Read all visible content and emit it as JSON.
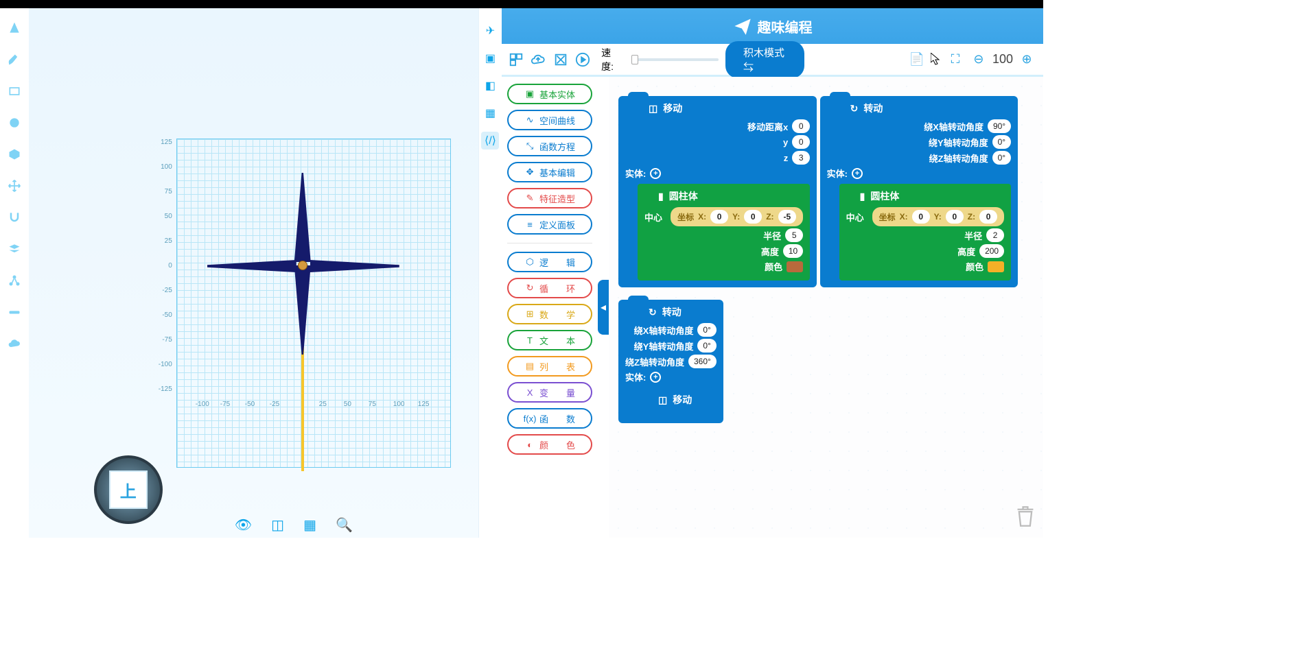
{
  "header": {
    "title": "趣味编程"
  },
  "toolbar": {
    "speed_label": "速度:",
    "mode_button": "积木模式 ⇆",
    "zoom_value": "100"
  },
  "categories_group1": [
    {
      "label": "基本实体",
      "cls": "cat-green",
      "icon": "▣",
      "name": "category-basic-entity"
    },
    {
      "label": "空间曲线",
      "cls": "cat-blue",
      "icon": "∿",
      "name": "category-space-curve"
    },
    {
      "label": "函数方程",
      "cls": "cat-blue",
      "icon": "⤡",
      "name": "category-function"
    },
    {
      "label": "基本编辑",
      "cls": "cat-blue",
      "icon": "✥",
      "name": "category-basic-edit"
    },
    {
      "label": "特征造型",
      "cls": "cat-red",
      "icon": "✎",
      "name": "category-feature"
    },
    {
      "label": "定义面板",
      "cls": "cat-blue",
      "icon": "≡",
      "name": "category-define-panel"
    }
  ],
  "categories_group2": [
    {
      "label": "逻　　辑",
      "cls": "cat-blue",
      "icon": "⬡",
      "name": "category-logic"
    },
    {
      "label": "循　　环",
      "cls": "cat-red",
      "icon": "↻",
      "name": "category-loop"
    },
    {
      "label": "数　　学",
      "cls": "cat-gold",
      "icon": "⊞",
      "name": "category-math"
    },
    {
      "label": "文　　本",
      "cls": "cat-green",
      "icon": "T",
      "name": "category-text"
    },
    {
      "label": "列　　表",
      "cls": "cat-orange",
      "icon": "▤",
      "name": "category-list"
    },
    {
      "label": "变　　量",
      "cls": "cat-violet",
      "icon": "X",
      "name": "category-variable"
    },
    {
      "label": "函　　数",
      "cls": "cat-blue",
      "icon": "f(x)",
      "name": "category-func"
    },
    {
      "label": "颜　　色",
      "cls": "cat-red",
      "icon": "◐",
      "name": "category-color"
    }
  ],
  "viewcube": {
    "face": "上"
  },
  "blocks": {
    "move1": {
      "title": "移动",
      "rows": [
        {
          "lbl": "移动距离x",
          "val": "0"
        },
        {
          "lbl": "y",
          "val": "0"
        },
        {
          "lbl": "z",
          "val": "3"
        }
      ],
      "entity_label": "实体:",
      "sub": {
        "title": "圆柱体",
        "center_label": "中心",
        "coord": {
          "prefix": "坐标",
          "x_lbl": "X:",
          "x": "0",
          "y_lbl": "Y:",
          "y": "0",
          "z_lbl": "Z:",
          "z": "-5"
        },
        "rows": [
          {
            "lbl": "半径",
            "val": "5"
          },
          {
            "lbl": "高度",
            "val": "10"
          }
        ],
        "color_label": "颜色",
        "color": "#b86a3c"
      }
    },
    "rotate1": {
      "title": "转动",
      "rows": [
        {
          "lbl": "绕X轴转动角度",
          "val": "90°"
        },
        {
          "lbl": "绕Y轴转动角度",
          "val": "0°"
        },
        {
          "lbl": "绕Z轴转动角度",
          "val": "0°"
        }
      ],
      "entity_label": "实体:",
      "sub": {
        "title": "圆柱体",
        "center_label": "中心",
        "coord": {
          "prefix": "坐标",
          "x_lbl": "X:",
          "x": "0",
          "y_lbl": "Y:",
          "y": "0",
          "z_lbl": "Z:",
          "z": "0"
        },
        "rows": [
          {
            "lbl": "半径",
            "val": "2"
          },
          {
            "lbl": "高度",
            "val": "200"
          }
        ],
        "color_label": "颜色",
        "color": "#f5b027"
      }
    },
    "rotate2": {
      "title": "转动",
      "rows": [
        {
          "lbl": "绕X轴转动角度",
          "val": "0°"
        },
        {
          "lbl": "绕Y轴转动角度",
          "val": "0°"
        },
        {
          "lbl": "绕Z轴转动角度",
          "val": "360°"
        }
      ],
      "entity_label": "实体:",
      "tail_title": "移动"
    }
  },
  "axis_labels": {
    "y": [
      "125",
      "100",
      "75",
      "50",
      "25",
      "0",
      "-25",
      "-50",
      "-75",
      "-100",
      "-125"
    ],
    "x": [
      "-100",
      "-75",
      "-50",
      "-25",
      "25",
      "50",
      "75",
      "100",
      "125"
    ]
  }
}
